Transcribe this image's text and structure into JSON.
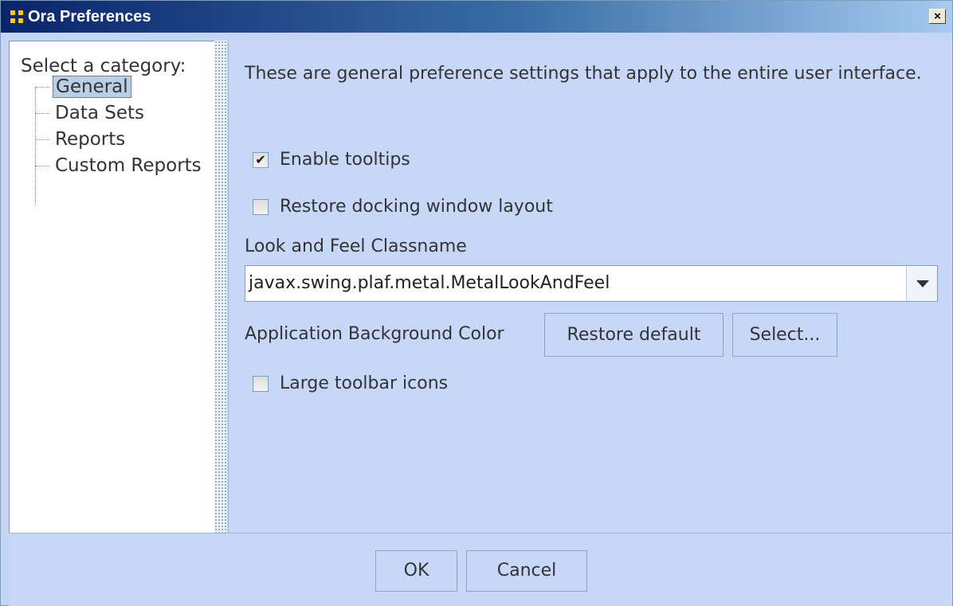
{
  "window": {
    "title": "Ora Preferences",
    "close_glyph": "×"
  },
  "sidebar": {
    "heading": "Select a category:",
    "items": [
      {
        "label": "General",
        "selected": true
      },
      {
        "label": "Data Sets",
        "selected": false
      },
      {
        "label": "Reports",
        "selected": false
      },
      {
        "label": "Custom Reports",
        "selected": false
      }
    ]
  },
  "general": {
    "description": "These are general preference settings that apply to the entire user interface.",
    "enable_tooltips": {
      "label": "Enable tooltips",
      "checked": true
    },
    "restore_docking": {
      "label": "Restore docking window layout",
      "checked": false
    },
    "laf_label": "Look and Feel Classname",
    "laf_value": "javax.swing.plaf.metal.MetalLookAndFeel",
    "bg_color_label": "Application Background Color",
    "restore_default_label": "Restore default",
    "select_label": "Select...",
    "large_icons": {
      "label": "Large toolbar icons",
      "checked": false
    }
  },
  "footer": {
    "ok_label": "OK",
    "cancel_label": "Cancel"
  },
  "icons": {
    "app": "ora-app-icon",
    "check": "checkmark-icon",
    "dropdown": "chevron-down-icon"
  },
  "colors": {
    "title_start": "#0a246a",
    "title_end": "#a6caf0",
    "panel_bg": "#c7d7f8",
    "selection": "#b8cfe5"
  }
}
